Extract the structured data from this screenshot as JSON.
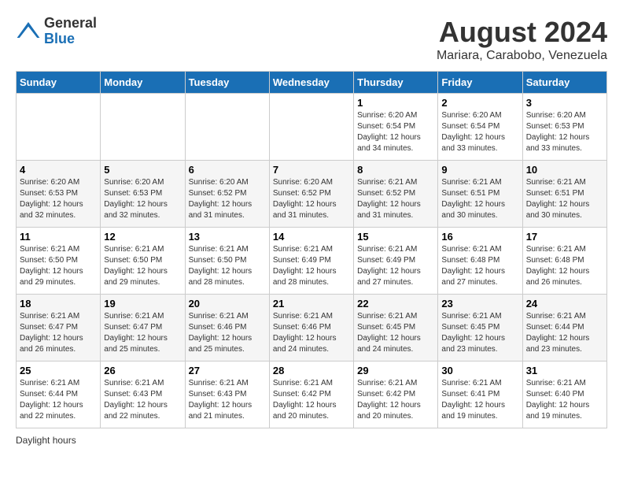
{
  "header": {
    "logo_general": "General",
    "logo_blue": "Blue",
    "month_year": "August 2024",
    "location": "Mariara, Carabobo, Venezuela"
  },
  "weekdays": [
    "Sunday",
    "Monday",
    "Tuesday",
    "Wednesday",
    "Thursday",
    "Friday",
    "Saturday"
  ],
  "weeks": [
    [
      {
        "day": "",
        "info": ""
      },
      {
        "day": "",
        "info": ""
      },
      {
        "day": "",
        "info": ""
      },
      {
        "day": "",
        "info": ""
      },
      {
        "day": "1",
        "info": "Sunrise: 6:20 AM\nSunset: 6:54 PM\nDaylight: 12 hours\nand 34 minutes."
      },
      {
        "day": "2",
        "info": "Sunrise: 6:20 AM\nSunset: 6:54 PM\nDaylight: 12 hours\nand 33 minutes."
      },
      {
        "day": "3",
        "info": "Sunrise: 6:20 AM\nSunset: 6:53 PM\nDaylight: 12 hours\nand 33 minutes."
      }
    ],
    [
      {
        "day": "4",
        "info": "Sunrise: 6:20 AM\nSunset: 6:53 PM\nDaylight: 12 hours\nand 32 minutes."
      },
      {
        "day": "5",
        "info": "Sunrise: 6:20 AM\nSunset: 6:53 PM\nDaylight: 12 hours\nand 32 minutes."
      },
      {
        "day": "6",
        "info": "Sunrise: 6:20 AM\nSunset: 6:52 PM\nDaylight: 12 hours\nand 31 minutes."
      },
      {
        "day": "7",
        "info": "Sunrise: 6:20 AM\nSunset: 6:52 PM\nDaylight: 12 hours\nand 31 minutes."
      },
      {
        "day": "8",
        "info": "Sunrise: 6:21 AM\nSunset: 6:52 PM\nDaylight: 12 hours\nand 31 minutes."
      },
      {
        "day": "9",
        "info": "Sunrise: 6:21 AM\nSunset: 6:51 PM\nDaylight: 12 hours\nand 30 minutes."
      },
      {
        "day": "10",
        "info": "Sunrise: 6:21 AM\nSunset: 6:51 PM\nDaylight: 12 hours\nand 30 minutes."
      }
    ],
    [
      {
        "day": "11",
        "info": "Sunrise: 6:21 AM\nSunset: 6:50 PM\nDaylight: 12 hours\nand 29 minutes."
      },
      {
        "day": "12",
        "info": "Sunrise: 6:21 AM\nSunset: 6:50 PM\nDaylight: 12 hours\nand 29 minutes."
      },
      {
        "day": "13",
        "info": "Sunrise: 6:21 AM\nSunset: 6:50 PM\nDaylight: 12 hours\nand 28 minutes."
      },
      {
        "day": "14",
        "info": "Sunrise: 6:21 AM\nSunset: 6:49 PM\nDaylight: 12 hours\nand 28 minutes."
      },
      {
        "day": "15",
        "info": "Sunrise: 6:21 AM\nSunset: 6:49 PM\nDaylight: 12 hours\nand 27 minutes."
      },
      {
        "day": "16",
        "info": "Sunrise: 6:21 AM\nSunset: 6:48 PM\nDaylight: 12 hours\nand 27 minutes."
      },
      {
        "day": "17",
        "info": "Sunrise: 6:21 AM\nSunset: 6:48 PM\nDaylight: 12 hours\nand 26 minutes."
      }
    ],
    [
      {
        "day": "18",
        "info": "Sunrise: 6:21 AM\nSunset: 6:47 PM\nDaylight: 12 hours\nand 26 minutes."
      },
      {
        "day": "19",
        "info": "Sunrise: 6:21 AM\nSunset: 6:47 PM\nDaylight: 12 hours\nand 25 minutes."
      },
      {
        "day": "20",
        "info": "Sunrise: 6:21 AM\nSunset: 6:46 PM\nDaylight: 12 hours\nand 25 minutes."
      },
      {
        "day": "21",
        "info": "Sunrise: 6:21 AM\nSunset: 6:46 PM\nDaylight: 12 hours\nand 24 minutes."
      },
      {
        "day": "22",
        "info": "Sunrise: 6:21 AM\nSunset: 6:45 PM\nDaylight: 12 hours\nand 24 minutes."
      },
      {
        "day": "23",
        "info": "Sunrise: 6:21 AM\nSunset: 6:45 PM\nDaylight: 12 hours\nand 23 minutes."
      },
      {
        "day": "24",
        "info": "Sunrise: 6:21 AM\nSunset: 6:44 PM\nDaylight: 12 hours\nand 23 minutes."
      }
    ],
    [
      {
        "day": "25",
        "info": "Sunrise: 6:21 AM\nSunset: 6:44 PM\nDaylight: 12 hours\nand 22 minutes."
      },
      {
        "day": "26",
        "info": "Sunrise: 6:21 AM\nSunset: 6:43 PM\nDaylight: 12 hours\nand 22 minutes."
      },
      {
        "day": "27",
        "info": "Sunrise: 6:21 AM\nSunset: 6:43 PM\nDaylight: 12 hours\nand 21 minutes."
      },
      {
        "day": "28",
        "info": "Sunrise: 6:21 AM\nSunset: 6:42 PM\nDaylight: 12 hours\nand 20 minutes."
      },
      {
        "day": "29",
        "info": "Sunrise: 6:21 AM\nSunset: 6:42 PM\nDaylight: 12 hours\nand 20 minutes."
      },
      {
        "day": "30",
        "info": "Sunrise: 6:21 AM\nSunset: 6:41 PM\nDaylight: 12 hours\nand 19 minutes."
      },
      {
        "day": "31",
        "info": "Sunrise: 6:21 AM\nSunset: 6:40 PM\nDaylight: 12 hours\nand 19 minutes."
      }
    ]
  ],
  "footer": {
    "daylight_label": "Daylight hours"
  }
}
